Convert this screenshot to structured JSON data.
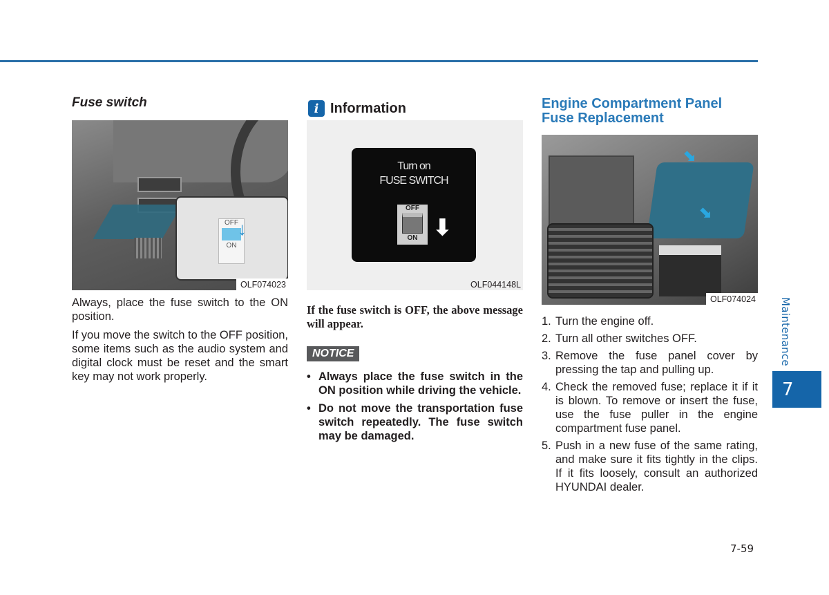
{
  "colors": {
    "accent": "#1565a9",
    "heading_blue": "#2a7ab8",
    "notice_bg": "#58595b"
  },
  "column1": {
    "heading": "Fuse switch",
    "figure": {
      "code": "OLF074023",
      "inset_labels": {
        "off": "OFF",
        "on": "ON"
      }
    },
    "paragraphs": [
      "Always, place the fuse switch to the ON position.",
      "If you move the switch to the OFF position, some items such as the audio system and digital clock must be reset and the smart key may not work properly."
    ]
  },
  "column2": {
    "info_icon": "info-icon",
    "info_glyph": "i",
    "heading": "Information",
    "figure": {
      "code": "OLF044148L",
      "screen_line1": "Turn on",
      "screen_line2": "FUSE SWITCH",
      "switch_off": "OFF",
      "switch_on": "ON"
    },
    "info_text": "If the fuse switch is OFF, the above message will appear.",
    "notice_label": "NOTICE",
    "notice_items": [
      "Always place the fuse switch in the ON position while driving the vehicle.",
      "Do not move the transportation fuse switch repeatedly. The fuse switch may be damaged."
    ]
  },
  "column3": {
    "heading": "Engine Compartment Panel Fuse Replacement",
    "figure": {
      "code": "OLF074024"
    },
    "steps": [
      {
        "num": "1.",
        "text": "Turn the engine off."
      },
      {
        "num": "2.",
        "text": "Turn all other switches OFF."
      },
      {
        "num": "3.",
        "text": "Remove the fuse panel cover by pressing the tap and pulling up."
      },
      {
        "num": "4.",
        "text": "Check the removed fuse; replace it if it is blown. To remove or insert the fuse, use the fuse puller in the engine compartment fuse panel."
      },
      {
        "num": "5.",
        "text": "Push in a new fuse of the same rating, and make sure it fits tightly in the clips. If it fits loosely, consult an authorized HYUNDAI dealer."
      }
    ]
  },
  "sidebar": {
    "section_label": "Maintenance",
    "chapter_number": "7"
  },
  "footer": {
    "page_number": "7-59"
  }
}
